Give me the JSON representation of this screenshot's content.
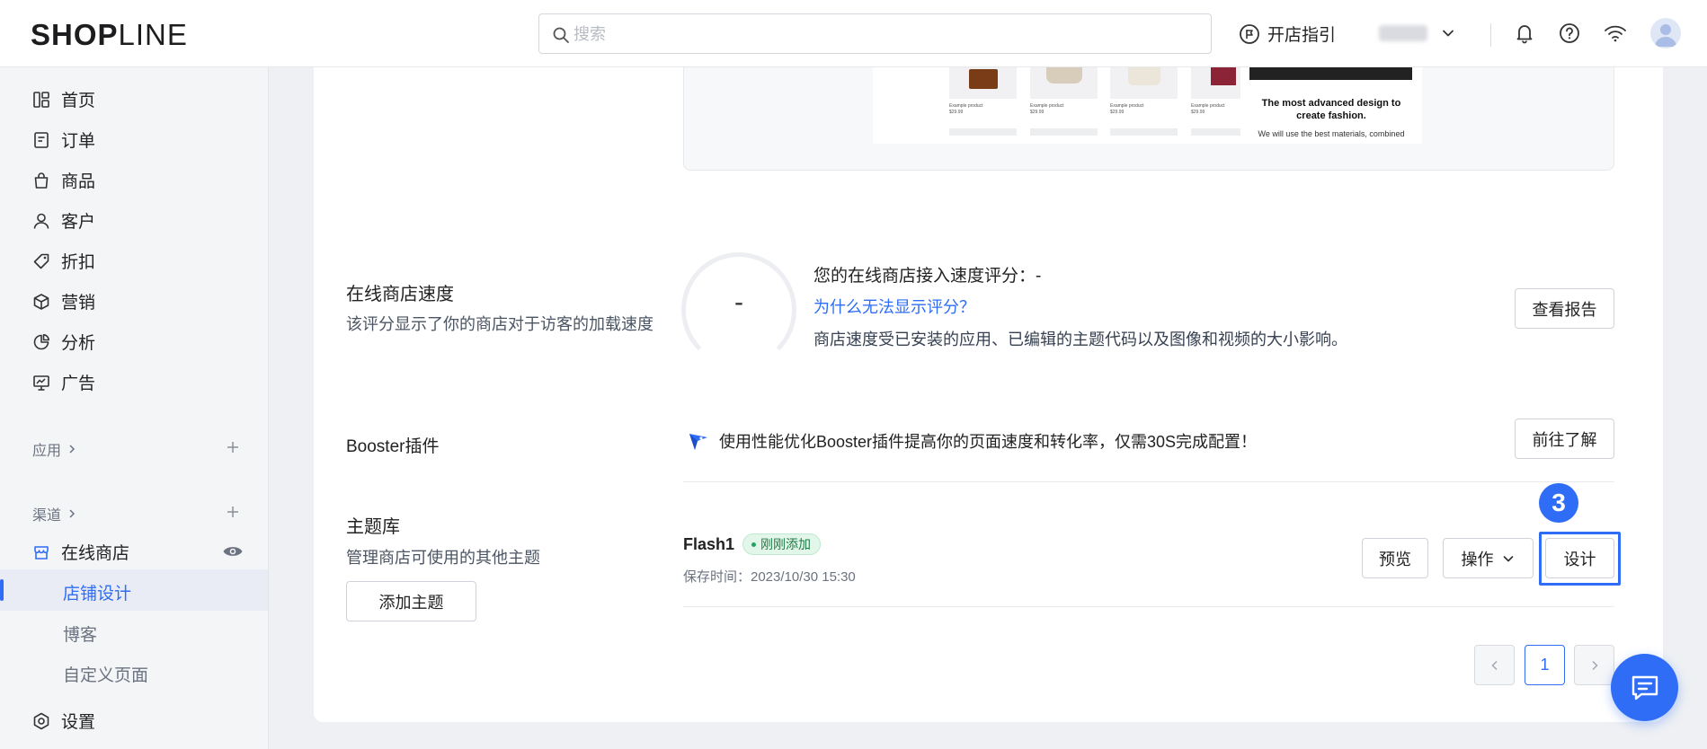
{
  "header": {
    "logo_bold": "SHOP",
    "logo_thin": "LINE",
    "search_placeholder": "搜索",
    "guide_label": "开店指引"
  },
  "sidebar": {
    "items": [
      {
        "label": "首页",
        "icon": "dashboard-icon"
      },
      {
        "label": "订单",
        "icon": "order-icon"
      },
      {
        "label": "商品",
        "icon": "bag-icon"
      },
      {
        "label": "客户",
        "icon": "user-icon"
      },
      {
        "label": "折扣",
        "icon": "tag-icon"
      },
      {
        "label": "营销",
        "icon": "cube-icon"
      },
      {
        "label": "分析",
        "icon": "pie-icon"
      },
      {
        "label": "广告",
        "icon": "ad-icon"
      }
    ],
    "apps_label": "应用",
    "channels_label": "渠道",
    "online_store_label": "在线商店",
    "sub_items": [
      "店铺设计",
      "博客",
      "自定义页面"
    ],
    "settings_label": "设置"
  },
  "preview": {
    "product_label": "Example product",
    "product_price": "$29.99",
    "hero_title": "The most advanced design to create fashion.",
    "hero_sub": "We will use the best materials, combined"
  },
  "speed": {
    "title": "在线商店速度",
    "desc": "该评分显示了你的商店对于访客的加载速度",
    "gauge_value": "-",
    "score_title": "您的在线商店接入速度评分：-",
    "score_link": "为什么无法显示评分？",
    "score_desc": "商店速度受已安装的应用、已编辑的主题代码以及图像和视频的大小影响。",
    "report_button": "查看报告"
  },
  "booster": {
    "title": "Booster插件",
    "desc": "使用性能优化Booster插件提高你的页面速度和转化率，仅需30S完成配置！",
    "learn_button": "前往了解"
  },
  "themes": {
    "title": "主题库",
    "desc": "管理商店可使用的其他主题",
    "add_button": "添加主题",
    "theme_name": "Flash1",
    "badge": "刚刚添加",
    "save_time": "保存时间：2023/10/30 15:30",
    "preview_button": "预览",
    "actions_button": "操作",
    "design_button": "设计",
    "step_number": "3"
  },
  "pagination": {
    "current_page": "1"
  },
  "colors": {
    "accent": "#2f6df6",
    "badge_bg": "#e3f6ea",
    "badge_text": "#1e7a45"
  }
}
